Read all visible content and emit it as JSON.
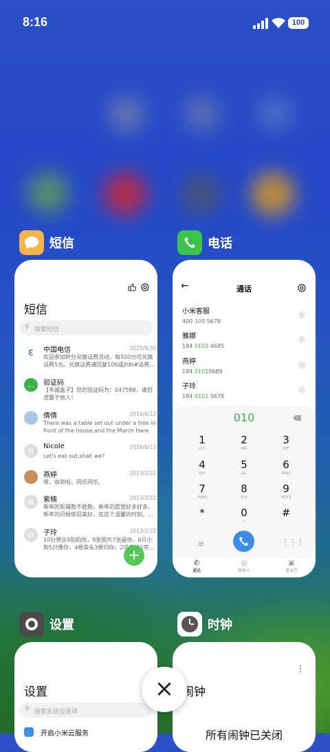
{
  "status": {
    "time": "8:16",
    "battery": "100"
  },
  "messages_app": {
    "name": "短信",
    "title": "短信",
    "search_placeholder": "搜索短信",
    "items": [
      {
        "name": "中国电信",
        "date": "2025/9/30",
        "preview": "欢迎参加积分兑换话费活动，每500分可兑换话费5元。兑换话费请回复106或jfdh#话费..."
      },
      {
        "name": "验证码",
        "date": "",
        "preview": "【韦城盒子】您的验证码为：047588，请勿泄露于他人！"
      },
      {
        "name": "倩倩",
        "date": "2016/6/13",
        "preview": "There was a table set out under a tree in front of the house,and the March Hare an..."
      },
      {
        "name": "Nicole",
        "date": "2016/6/13",
        "preview": "Let's eat out,shall we?"
      },
      {
        "name": "燕婷",
        "date": "2013/2/22",
        "preview": "嗯，收到啦，同乐同乐。"
      },
      {
        "name": "紫楠",
        "date": "2013/2/22",
        "preview": "新年的祝福数不胜数，新年的愿望好多好多，新年的问候依旧美好，在这个温馨的时刻，..."
      },
      {
        "name": "子玲",
        "date": "2013/2/22",
        "preview": "10分想念9别的你，8张照片7张是你，6只小狗5只像你，4根骨头3根归你，2爪着地1完..."
      }
    ],
    "avatar_letters": {
      "nicole": "N",
      "zinan": "楠",
      "ziling": "玲"
    },
    "fab": "+"
  },
  "phone_app": {
    "name": "电话",
    "title": "通话",
    "contacts": [
      {
        "name": "小米客服",
        "pre": "400 ",
        "hl": "10",
        "post": "0 5678"
      },
      {
        "name": "雅娜",
        "pre": "184 ",
        "hl": "0102",
        "post": " 4685"
      },
      {
        "name": "燕婷",
        "pre": "184 ",
        "hl": "010",
        "post": "15689"
      },
      {
        "name": "子玲",
        "pre": "184 ",
        "hl": "0101",
        "post": " 5678"
      }
    ],
    "dial_input": "010",
    "keys": [
      {
        "d": "1",
        "l": "Q,O"
      },
      {
        "d": "2",
        "l": "ABC"
      },
      {
        "d": "3",
        "l": "DEF"
      },
      {
        "d": "4",
        "l": "GHI"
      },
      {
        "d": "5",
        "l": "JKL"
      },
      {
        "d": "6",
        "l": "MNO"
      },
      {
        "d": "7",
        "l": "PQRS"
      },
      {
        "d": "8",
        "l": "TUV"
      },
      {
        "d": "9",
        "l": "WXYZ"
      },
      {
        "d": "*",
        "l": ""
      },
      {
        "d": "0",
        "l": "+"
      },
      {
        "d": "#",
        "l": ""
      }
    ],
    "tabs": [
      "通话",
      "联系人",
      "营业厅"
    ]
  },
  "settings_app": {
    "name": "设置",
    "title": "设置",
    "search_placeholder": "搜索系统设置项",
    "first_item": "开启小米云服务"
  },
  "clock_app": {
    "name": "时钟",
    "title": "闹钟",
    "empty": "所有闹钟已关闭",
    "menu": "⋮"
  },
  "close_button": "×"
}
